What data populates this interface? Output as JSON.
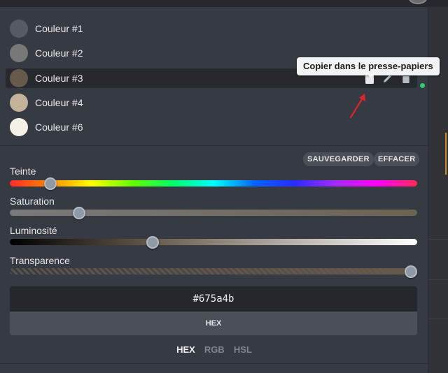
{
  "palette": {
    "items": [
      {
        "label": "Couleur #1",
        "color": "#565b63"
      },
      {
        "label": "Couleur #2",
        "color": "#787878"
      },
      {
        "label": "Couleur #3",
        "color": "#675a4b"
      },
      {
        "label": "Couleur #4",
        "color": "#c4b29a"
      },
      {
        "label": "Couleur #6",
        "color": "#f6f1e6"
      }
    ],
    "active_index": 2,
    "row_actions": [
      "clipboard-icon",
      "pencil-icon",
      "trash-icon"
    ]
  },
  "tooltip": {
    "text": "Copier dans le presse-papiers"
  },
  "actions": {
    "save_label": "SAUVEGARDER",
    "clear_label": "EFFACER"
  },
  "sliders": {
    "hue": {
      "label": "Teinte",
      "value": 0.1
    },
    "saturation": {
      "label": "Saturation",
      "value": 0.17
    },
    "luminosity": {
      "label": "Luminosité",
      "value": 0.35
    },
    "transparency": {
      "label": "Transparence",
      "value": 1.0
    }
  },
  "color_value": {
    "hex": "#675a4b",
    "mode_label": "HEX"
  },
  "formats": {
    "tabs": [
      "HEX",
      "RGB",
      "HSL"
    ],
    "active": "HEX"
  },
  "colors": {
    "accent_green": "#2ecc71",
    "annotation_red": "#e0242a"
  }
}
